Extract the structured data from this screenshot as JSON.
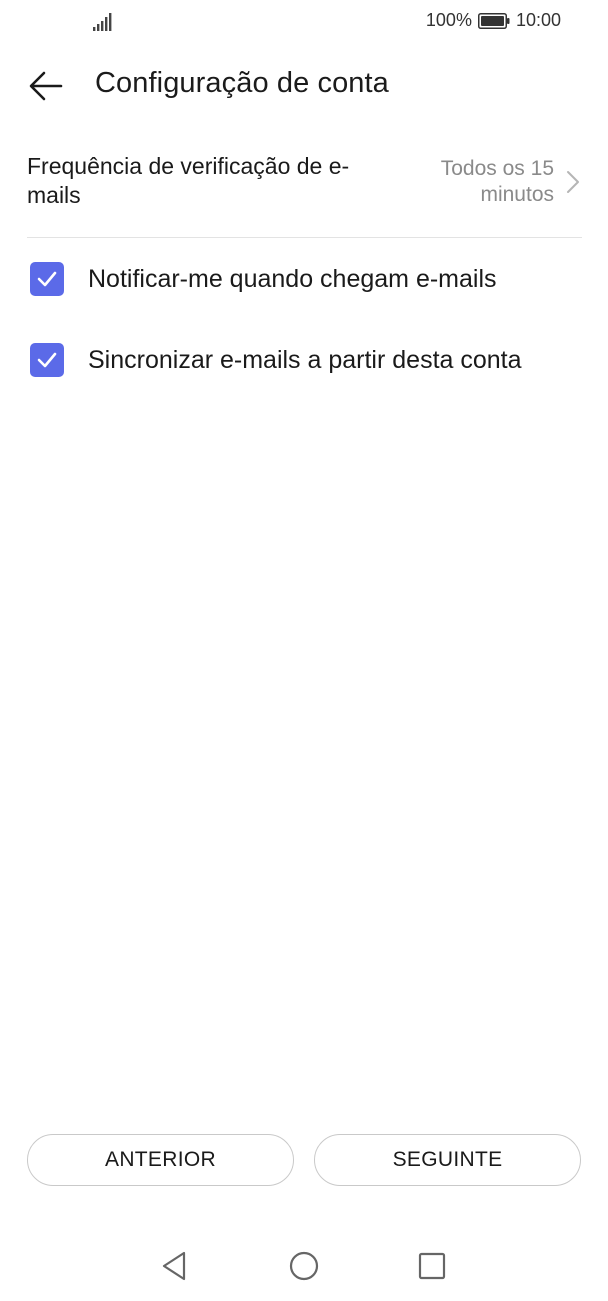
{
  "status_bar": {
    "battery_percent": "100%",
    "time": "10:00",
    "icons": [
      "signal-icon",
      "battery-icon"
    ]
  },
  "header": {
    "back_icon": "arrow-left-icon",
    "title": "Configuração de conta"
  },
  "frequency": {
    "label": "Frequência de verificação de e-mails",
    "value": "Todos os 15 minutos",
    "icon": "chevron-right-icon"
  },
  "options": [
    {
      "label": "Notificar-me quando chegam e-mails",
      "checked": true
    },
    {
      "label": "Sincronizar e-mails a partir desta conta",
      "checked": true
    }
  ],
  "buttons": {
    "previous": "ANTERIOR",
    "next": "SEGUINTE"
  },
  "navbar": {
    "icons": [
      "nav-back-icon",
      "nav-home-icon",
      "nav-recent-icon"
    ]
  },
  "colors": {
    "accent": "#5b6ae8",
    "secondary_text": "#8a8a8a",
    "divider": "#e3e3e3"
  }
}
